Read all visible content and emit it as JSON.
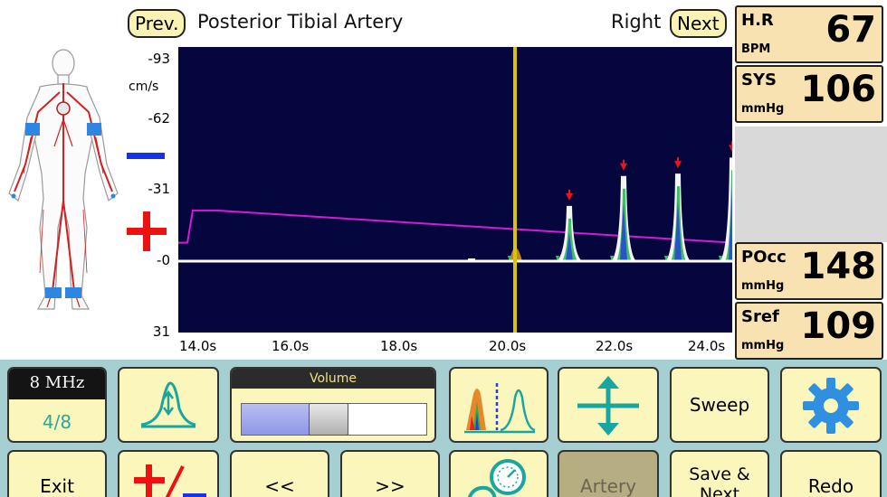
{
  "header": {
    "prev_label": "Prev.",
    "artery_name": "Posterior Tibial Artery",
    "side": "Right",
    "next_label": "Next"
  },
  "spectrogram": {
    "y_unit": "cm/s",
    "y_ticks": [
      "-93",
      "-62",
      "-31",
      "-0",
      "31"
    ],
    "x_ticks": [
      "14.0s",
      "16.0s",
      "18.0s",
      "20.0s",
      "22.0s",
      "24.0s"
    ],
    "x_range_s": [
      13.8,
      24.0
    ],
    "y_range_cm_s": [
      -93,
      31
    ],
    "cursor_time_s": 20.0,
    "peaks_time_s": [
      21.0,
      22.0,
      23.0,
      24.0
    ],
    "peaks_velocity_cm_s": [
      -24,
      -37,
      -38,
      -45
    ],
    "pressure_trace": {
      "start_time_s": 13.8,
      "rise_time_s": 14.0,
      "start_level": -8,
      "peak_level": -22,
      "end_level": -8,
      "end_time_s": 24.0
    },
    "colors": {
      "background": "#06063f",
      "baseline": "#ffffff",
      "cursor": "#d7c20e",
      "trace": "#d41ad6",
      "peak_marker": "#e8151b"
    }
  },
  "metrics": [
    {
      "label": "H.R",
      "unit": "BPM",
      "value": "67"
    },
    {
      "label": "SYS",
      "unit": "mmHg",
      "value": "106"
    },
    {
      "label": "POcc",
      "unit": "mmHg",
      "value": "148"
    },
    {
      "label": "Sref",
      "unit": "mmHg",
      "value": "109"
    }
  ],
  "toolbar": {
    "frequency": "8 MHz",
    "gain": "4/8",
    "volume_label": "Volume",
    "volume_level": 0.46,
    "sweep_label": "Sweep",
    "exit_label": "Exit",
    "back_label": "<<",
    "forward_label": ">>",
    "artery_label": "Artery",
    "save_label": "Save & Next",
    "redo_label": "Redo"
  },
  "icons": {
    "waveform": "waveform-icon",
    "spectrum": "spectrum-icon",
    "scale": "vertical-scale-icon",
    "settings": "gear-icon",
    "polarity": "polarity-icon",
    "cuff": "pressure-gauge-icon"
  }
}
